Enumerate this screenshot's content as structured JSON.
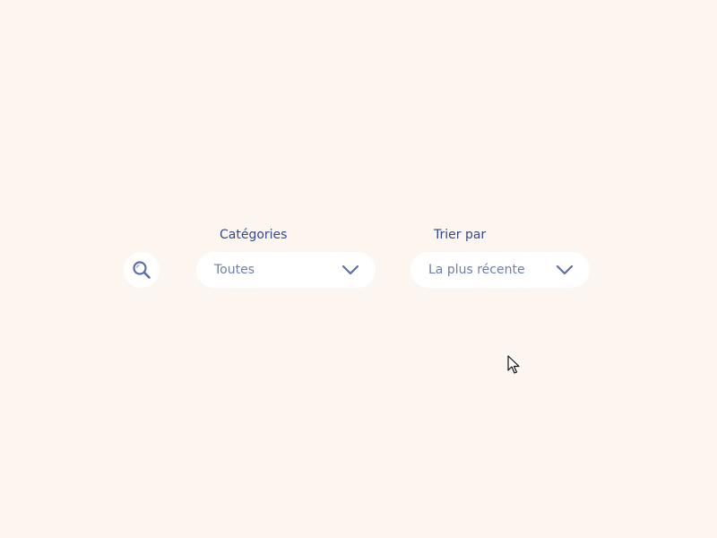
{
  "filters": {
    "search": {
      "icon": "search-icon"
    },
    "category": {
      "label": "Catégories",
      "value": "Toutes",
      "icon": "chevron-down-icon"
    },
    "sort": {
      "label": "Trier par",
      "value": "La plus récente",
      "icon": "chevron-down-icon"
    }
  },
  "colors": {
    "background": "#fdf5f0",
    "label": "#2f4b8a",
    "value": "#6b7fa8",
    "icon": "#5b6fae",
    "field": "#ffffff"
  }
}
